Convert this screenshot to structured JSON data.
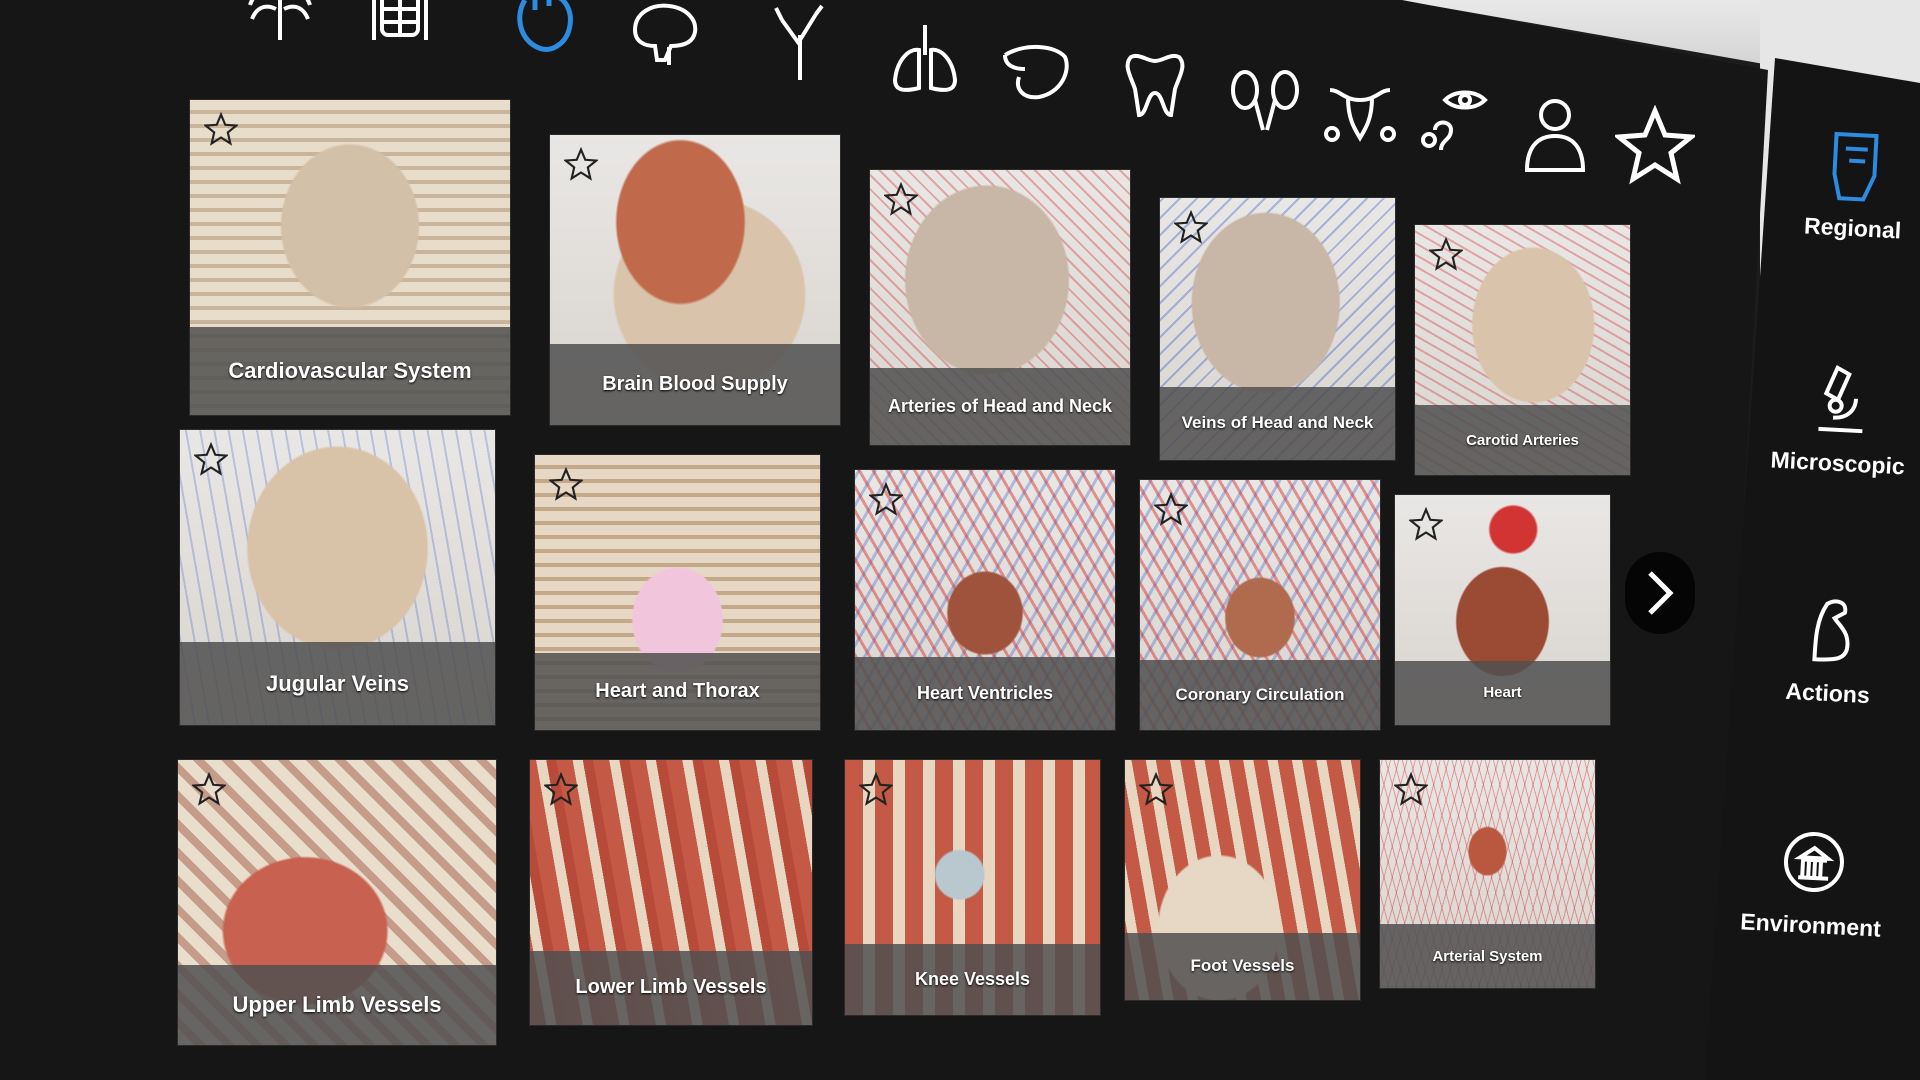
{
  "categories": [
    {
      "name": "skeletal",
      "icon": "ribcage-icon"
    },
    {
      "name": "muscular",
      "icon": "torso-muscle-icon"
    },
    {
      "name": "cardiovascular",
      "icon": "heart-icon",
      "active": true
    },
    {
      "name": "nervous",
      "icon": "brain-icon"
    },
    {
      "name": "lymphatic",
      "icon": "branch-icon"
    },
    {
      "name": "respiratory",
      "icon": "lungs-icon"
    },
    {
      "name": "digestive",
      "icon": "stomach-icon"
    },
    {
      "name": "teeth",
      "icon": "tooth-icon"
    },
    {
      "name": "urinary",
      "icon": "kidneys-icon"
    },
    {
      "name": "reproductive",
      "icon": "uterus-gender-icon"
    },
    {
      "name": "senses",
      "icon": "eye-ear-icon"
    },
    {
      "name": "skin",
      "icon": "person-silhouette-icon"
    },
    {
      "name": "favorites",
      "icon": "star-icon"
    }
  ],
  "accent": "#2b8ce0",
  "tiles": [
    {
      "label": "Cardiovascular System"
    },
    {
      "label": "Brain Blood Supply"
    },
    {
      "label": "Arteries of Head and Neck"
    },
    {
      "label": "Veins of Head and Neck"
    },
    {
      "label": "Carotid Arteries"
    },
    {
      "label": "Jugular Veins"
    },
    {
      "label": "Heart and Thorax"
    },
    {
      "label": "Heart Ventricles"
    },
    {
      "label": "Coronary Circulation"
    },
    {
      "label": "Heart"
    },
    {
      "label": "Upper Limb Vessels"
    },
    {
      "label": "Lower Limb Vessels"
    },
    {
      "label": "Knee Vessels"
    },
    {
      "label": "Foot Vessels"
    },
    {
      "label": "Arterial System"
    }
  ],
  "sidebar": {
    "items": [
      {
        "label": "Regional",
        "icon": "regional-body-icon",
        "active": true
      },
      {
        "label": "Microscopic",
        "icon": "microscope-icon"
      },
      {
        "label": "Actions",
        "icon": "flexed-arm-icon"
      },
      {
        "label": "Environment",
        "icon": "environment-museum-icon"
      }
    ]
  },
  "next_icon": "chevron-right-icon"
}
